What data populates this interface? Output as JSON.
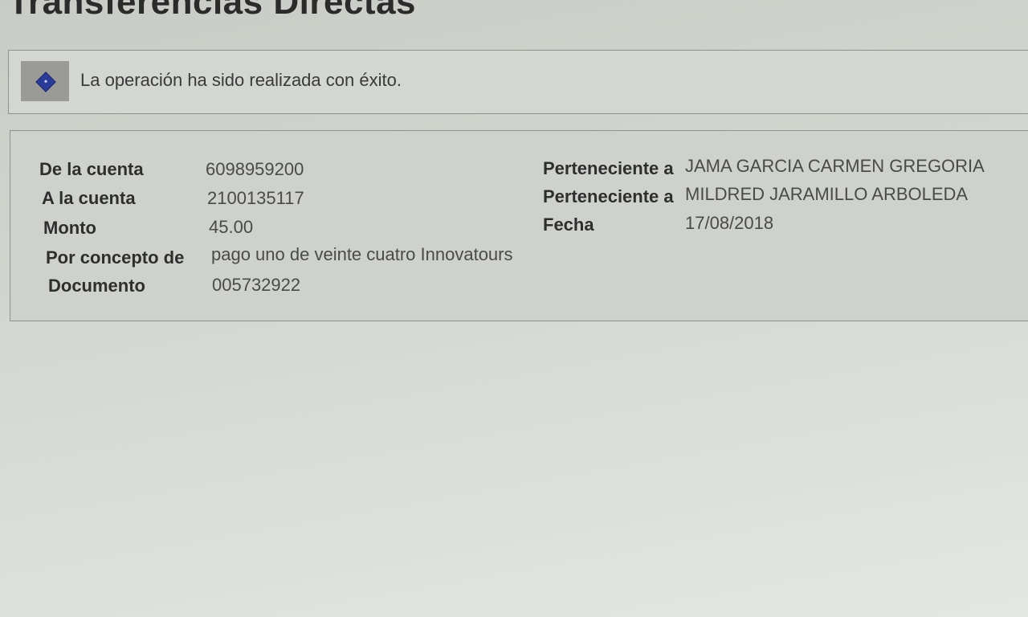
{
  "page": {
    "title": "Transferencias Directas"
  },
  "message": {
    "icon": "info-icon",
    "text": "La operación ha sido realizada con éxito."
  },
  "details": {
    "from_account_label": "De la cuenta",
    "from_account_value": "6098959200",
    "to_account_label": "A la cuenta",
    "to_account_value": "2100135117",
    "amount_label": "Monto",
    "amount_value": "45.00",
    "concept_label": "Por concepto de",
    "concept_value": "pago uno de veinte cuatro Innovatours",
    "document_label": "Documento",
    "document_value": "005732922",
    "from_owner_label": "Perteneciente a",
    "from_owner_value": "JAMA GARCIA CARMEN GREGORIA",
    "to_owner_label": "Perteneciente a",
    "to_owner_value": "MILDRED JARAMILLO ARBOLEDA",
    "date_label": "Fecha",
    "date_value": "17/08/2018"
  }
}
